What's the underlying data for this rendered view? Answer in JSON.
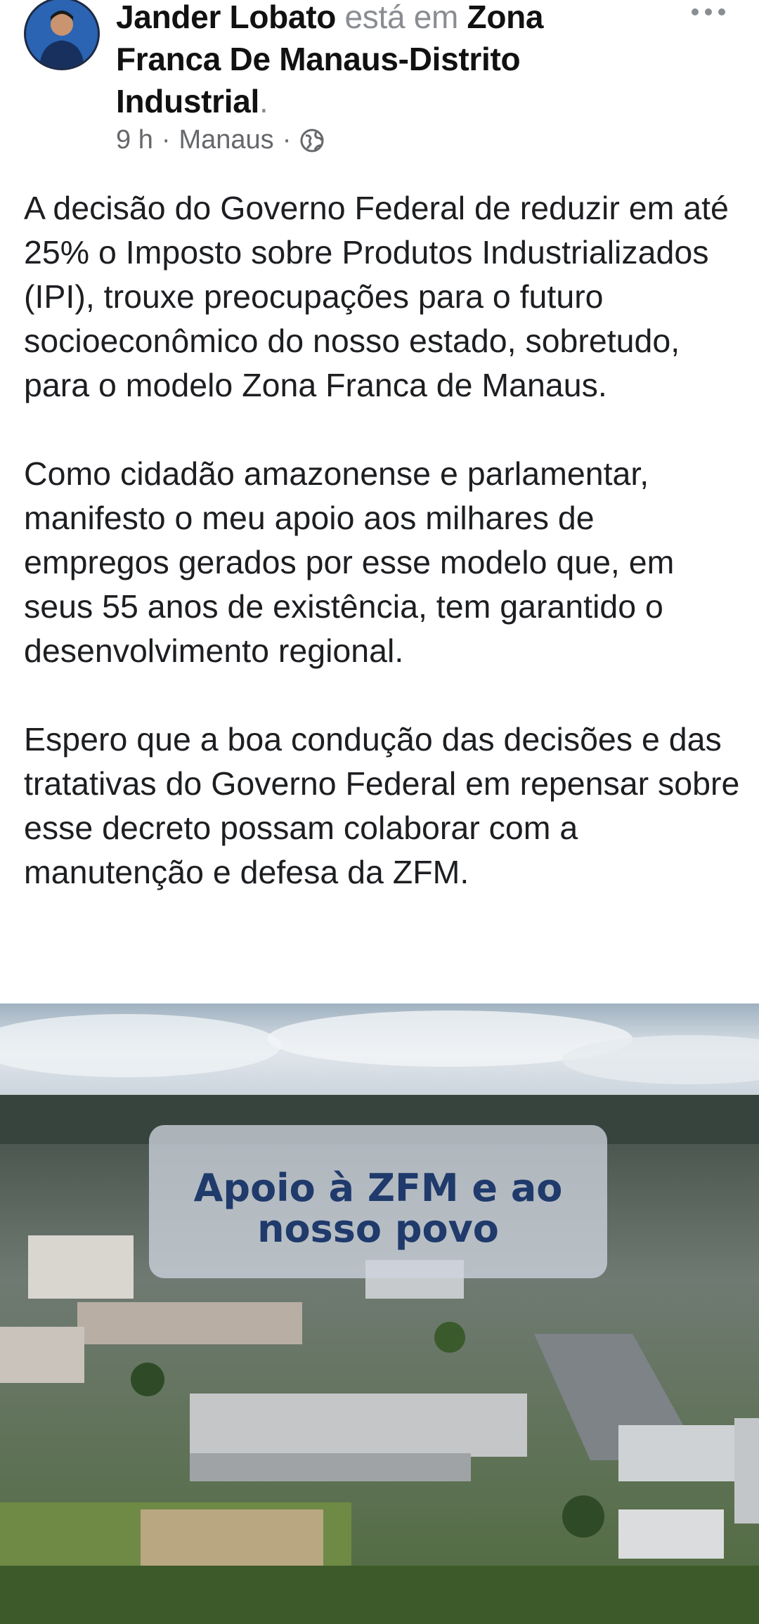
{
  "post": {
    "author": "Jander Lobato",
    "connector": "está em",
    "location_name": "Zona Franca De Manaus-Distrito Industrial",
    "location_suffix": ".",
    "time": "9 h",
    "separator": "·",
    "city": "Manaus",
    "privacy_icon": "globe-icon",
    "more_icon": "more-horizontal-icon",
    "paragraphs": [
      "A decisão do Governo Federal de reduzir em até 25% o Imposto sobre Produtos Industrializados (IPI), trouxe preocupações para o futuro socioeconômico do nosso estado, sobretudo, para o modelo Zona Franca de Manaus.",
      "Como cidadão amazonense e parlamentar, manifesto o meu apoio aos milhares de empregos gerados por esse modelo que, em seus 55 anos de existência, tem garantido o desenvolvimento regional.",
      "Espero que a boa condução das decisões e das tratativas do Governo Federal em repensar sobre esse decreto possam colaborar com a manutenção e defesa da ZFM."
    ],
    "image_overlay_text": "Apoio à ZFM e ao nosso povo"
  },
  "colors": {
    "text": "#1c1e21",
    "muted": "#65676b",
    "overlay_text": "#1f3a6b"
  }
}
